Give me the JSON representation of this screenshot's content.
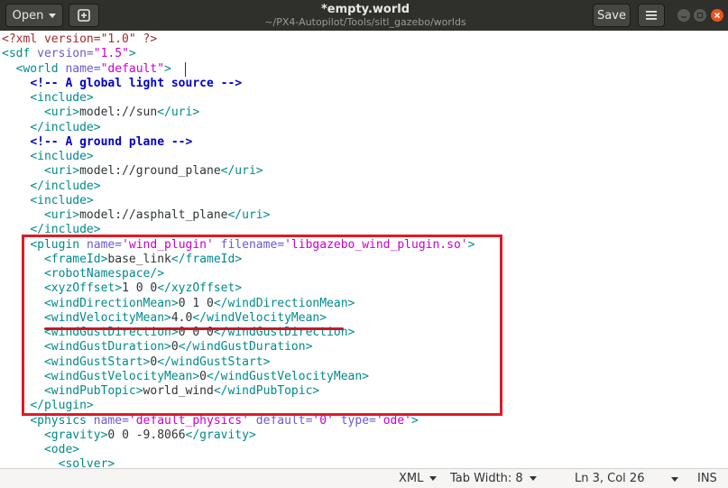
{
  "header": {
    "open_label": "Open",
    "title": "*empty.world",
    "subtitle": "~/PX4-Autopilot/Tools/sitl_gazebo/worlds",
    "save_label": "Save"
  },
  "editor": {
    "lines": [
      {
        "indent": "",
        "parts": [
          {
            "c": "proc",
            "t": "<?xml version=\"1.0\" ?>"
          }
        ]
      },
      {
        "indent": "",
        "parts": [
          {
            "c": "tag",
            "t": "<sdf "
          },
          {
            "c": "attr",
            "t": "version="
          },
          {
            "c": "str",
            "t": "\"1.5\""
          },
          {
            "c": "tag",
            "t": ">"
          }
        ]
      },
      {
        "indent": "  ",
        "parts": [
          {
            "c": "tag",
            "t": "<world "
          },
          {
            "c": "attr",
            "t": "name="
          },
          {
            "c": "str",
            "t": "\"default\""
          },
          {
            "c": "tag",
            "t": ">"
          }
        ]
      },
      {
        "indent": "    ",
        "parts": [
          {
            "c": "cmt",
            "t": "<!-- A global light source -->"
          }
        ]
      },
      {
        "indent": "    ",
        "parts": [
          {
            "c": "tag",
            "t": "<include>"
          }
        ]
      },
      {
        "indent": "      ",
        "parts": [
          {
            "c": "tag",
            "t": "<uri>"
          },
          {
            "c": "",
            "t": "model://sun"
          },
          {
            "c": "tag",
            "t": "</uri>"
          }
        ]
      },
      {
        "indent": "    ",
        "parts": [
          {
            "c": "tag",
            "t": "</include>"
          }
        ]
      },
      {
        "indent": "    ",
        "parts": [
          {
            "c": "cmt",
            "t": "<!-- A ground plane -->"
          }
        ]
      },
      {
        "indent": "    ",
        "parts": [
          {
            "c": "tag",
            "t": "<include>"
          }
        ]
      },
      {
        "indent": "      ",
        "parts": [
          {
            "c": "tag",
            "t": "<uri>"
          },
          {
            "c": "",
            "t": "model://ground_plane"
          },
          {
            "c": "tag",
            "t": "</uri>"
          }
        ]
      },
      {
        "indent": "    ",
        "parts": [
          {
            "c": "tag",
            "t": "</include>"
          }
        ]
      },
      {
        "indent": "    ",
        "parts": [
          {
            "c": "tag",
            "t": "<include>"
          }
        ]
      },
      {
        "indent": "      ",
        "parts": [
          {
            "c": "tag",
            "t": "<uri>"
          },
          {
            "c": "",
            "t": "model://asphalt_plane"
          },
          {
            "c": "tag",
            "t": "</uri>"
          }
        ]
      },
      {
        "indent": "    ",
        "parts": [
          {
            "c": "tag",
            "t": "</include>"
          }
        ]
      },
      {
        "indent": "    ",
        "parts": [
          {
            "c": "tag",
            "t": "<plugin "
          },
          {
            "c": "attr",
            "t": "name="
          },
          {
            "c": "str",
            "t": "'wind_plugin'"
          },
          {
            "c": "",
            "t": " "
          },
          {
            "c": "attr",
            "t": "filename="
          },
          {
            "c": "str",
            "t": "'libgazebo_wind_plugin.so'"
          },
          {
            "c": "tag",
            "t": ">"
          }
        ]
      },
      {
        "indent": "      ",
        "parts": [
          {
            "c": "tag",
            "t": "<frameId>"
          },
          {
            "c": "",
            "t": "base_link"
          },
          {
            "c": "tag",
            "t": "</frameId>"
          }
        ]
      },
      {
        "indent": "      ",
        "parts": [
          {
            "c": "tag",
            "t": "<robotNamespace/>"
          }
        ]
      },
      {
        "indent": "      ",
        "parts": [
          {
            "c": "tag",
            "t": "<xyzOffset>"
          },
          {
            "c": "",
            "t": "1 0 0"
          },
          {
            "c": "tag",
            "t": "</xyzOffset>"
          }
        ]
      },
      {
        "indent": "      ",
        "parts": [
          {
            "c": "tag",
            "t": "<windDirectionMean>"
          },
          {
            "c": "",
            "t": "0 1 0"
          },
          {
            "c": "tag",
            "t": "</windDirectionMean>"
          }
        ]
      },
      {
        "indent": "      ",
        "parts": [
          {
            "c": "tag",
            "t": "<windVelocityMean>"
          },
          {
            "c": "",
            "t": "4.0"
          },
          {
            "c": "tag",
            "t": "</windVelocityMean>"
          }
        ]
      },
      {
        "indent": "      ",
        "parts": [
          {
            "c": "tag",
            "t": "<windGustDirection>"
          },
          {
            "c": "",
            "t": "0 0 0"
          },
          {
            "c": "tag",
            "t": "</windGustDirection>"
          }
        ]
      },
      {
        "indent": "      ",
        "parts": [
          {
            "c": "tag",
            "t": "<windGustDuration>"
          },
          {
            "c": "",
            "t": "0"
          },
          {
            "c": "tag",
            "t": "</windGustDuration>"
          }
        ]
      },
      {
        "indent": "      ",
        "parts": [
          {
            "c": "tag",
            "t": "<windGustStart>"
          },
          {
            "c": "",
            "t": "0"
          },
          {
            "c": "tag",
            "t": "</windGustStart>"
          }
        ]
      },
      {
        "indent": "      ",
        "parts": [
          {
            "c": "tag",
            "t": "<windGustVelocityMean>"
          },
          {
            "c": "",
            "t": "0"
          },
          {
            "c": "tag",
            "t": "</windGustVelocityMean>"
          }
        ]
      },
      {
        "indent": "      ",
        "parts": [
          {
            "c": "tag",
            "t": "<windPubTopic>"
          },
          {
            "c": "",
            "t": "world_wind"
          },
          {
            "c": "tag",
            "t": "</windPubTopic>"
          }
        ]
      },
      {
        "indent": "    ",
        "parts": [
          {
            "c": "tag",
            "t": "</plugin>"
          }
        ]
      },
      {
        "indent": "    ",
        "parts": [
          {
            "c": "tag",
            "t": "<physics "
          },
          {
            "c": "attr",
            "t": "name="
          },
          {
            "c": "str",
            "t": "'default_physics'"
          },
          {
            "c": "",
            "t": " "
          },
          {
            "c": "attr",
            "t": "default="
          },
          {
            "c": "str",
            "t": "'0'"
          },
          {
            "c": "",
            "t": " "
          },
          {
            "c": "attr",
            "t": "type="
          },
          {
            "c": "str",
            "t": "'ode'"
          },
          {
            "c": "tag",
            "t": ">"
          }
        ]
      },
      {
        "indent": "      ",
        "parts": [
          {
            "c": "tag",
            "t": "<gravity>"
          },
          {
            "c": "",
            "t": "0 0 -9.8066"
          },
          {
            "c": "tag",
            "t": "</gravity>"
          }
        ]
      },
      {
        "indent": "      ",
        "parts": [
          {
            "c": "tag",
            "t": "<ode>"
          }
        ]
      },
      {
        "indent": "        ",
        "parts": [
          {
            "c": "tag",
            "t": "<solver>"
          }
        ]
      }
    ]
  },
  "status": {
    "language": "XML",
    "tab_width": "Tab Width: 8",
    "cursor_position": "Ln 3, Col 26",
    "insert_mode": "INS"
  },
  "colors": {
    "highlight_box": "#e01b24",
    "underline": "#c01c28",
    "close_button": "#e95420"
  },
  "icons": [
    "chevron-down-icon",
    "new-tab-icon",
    "hamburger-menu-icon",
    "minimize-icon",
    "maximize-icon",
    "close-icon"
  ]
}
